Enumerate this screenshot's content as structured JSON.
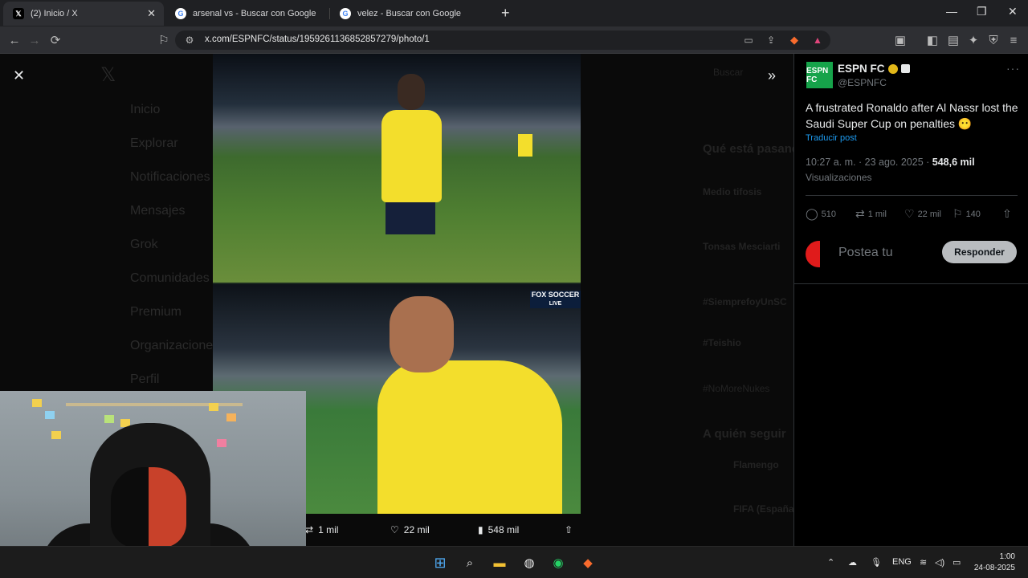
{
  "browser": {
    "tabs": [
      {
        "title": "(2) Inicio / X",
        "favicon": "x-logo",
        "active": true
      },
      {
        "title": "arsenal vs - Buscar con Google",
        "favicon": "google-logo",
        "active": false
      },
      {
        "title": "velez - Buscar con Google",
        "favicon": "google-logo",
        "active": false
      }
    ],
    "url": "x.com/ESPNFC/status/1959261136852857279/photo/1"
  },
  "background_nav": [
    "Inicio",
    "Explorar",
    "Notificaciones",
    "Mensajes",
    "Grok",
    "Comunidades",
    "Premium",
    "Organizaciones",
    "Perfil"
  ],
  "photo_stats": {
    "reposts": "1 mil",
    "likes": "22 mil",
    "views": "548 mil"
  },
  "photo_overlay": {
    "broadcaster": "FOX SOCCER",
    "live": "LIVE"
  },
  "post": {
    "author_name": "ESPN FC",
    "author_avatar": "ESPN FC",
    "handle": "@ESPNFC",
    "text": "A frustrated Ronaldo after Al Nassr lost the Saudi Super Cup on penalties 😶",
    "translate": "Traducir post",
    "time": "10:27 a. m.",
    "date": "23 ago. 2025",
    "views_count": "548,6 mil",
    "views_label": "Visualizaciones",
    "replies": "510",
    "reposts": "1 mil",
    "likes": "22 mil",
    "bookmarks": "140",
    "reply_placeholder": "Postea tu",
    "reply_button": "Responder"
  },
  "background_side": {
    "search": "Buscar",
    "trending_title": "Qué está pasando",
    "trends": [
      "Medio tifosis",
      "Tonsas Mesciarti",
      "#SiemprefoyUnSC",
      "#Teishio",
      "#NoMoreNukes"
    ],
    "who_to_follow": "A quién seguir",
    "follow": [
      "Flamengo",
      "FIFA (España)"
    ]
  },
  "taskbar": {
    "language": "ENG",
    "time": "1:00",
    "date": "24-08-2025"
  },
  "colors": {
    "x_blue": "#1d9bf0",
    "espn_green": "#16a34a",
    "jersey_yellow": "#f3de2c"
  }
}
